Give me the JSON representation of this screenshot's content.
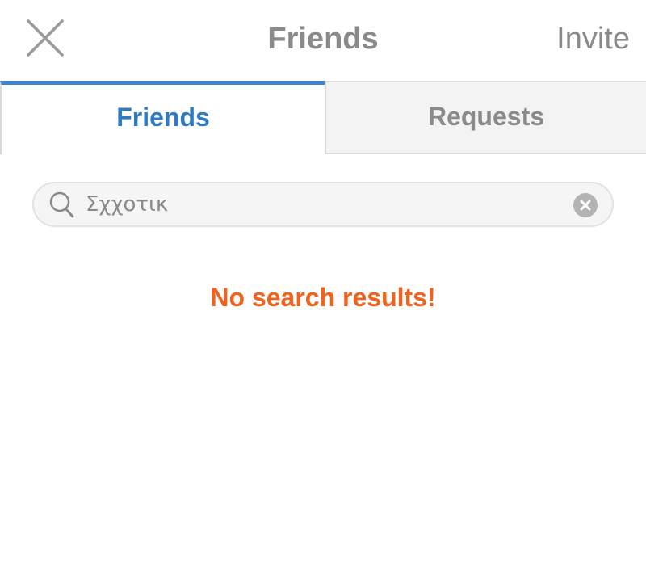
{
  "header": {
    "title": "Friends",
    "invite_label": "Invite",
    "close_icon": "close-icon"
  },
  "tabs": [
    {
      "label": "Friends",
      "active": true
    },
    {
      "label": "Requests",
      "active": false
    }
  ],
  "search": {
    "value": "Σχχοτικ",
    "placeholder": "",
    "search_icon": "search-icon",
    "clear_icon": "clear-icon"
  },
  "message": {
    "text": "No search results!"
  },
  "colors": {
    "accent_blue": "#3a86cf",
    "tab_active_text": "#2e7bc4",
    "muted_text": "#8a8a8a",
    "warning_orange": "#f0631f"
  }
}
